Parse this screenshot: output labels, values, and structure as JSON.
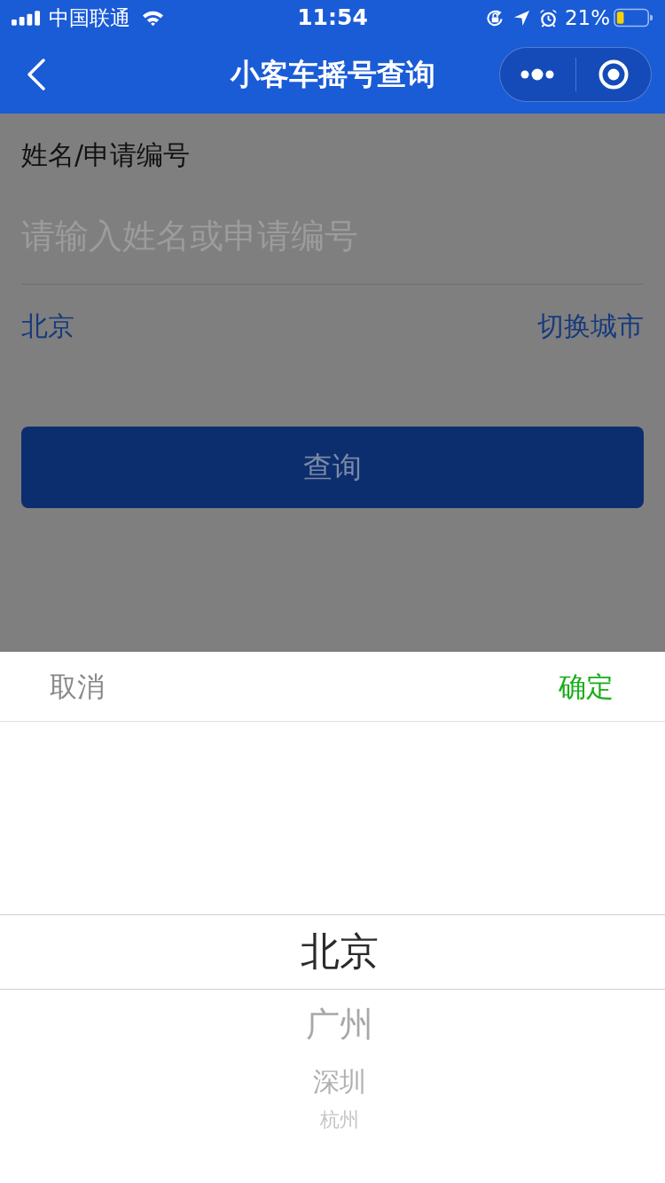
{
  "status_bar": {
    "carrier": "中国联通",
    "time": "11:54",
    "battery": "21%"
  },
  "nav_bar": {
    "title": "小客车摇号查询"
  },
  "form": {
    "label": "姓名/申请编号",
    "input": {
      "placeholder": "请输入姓名或申请编号"
    },
    "city": "北京",
    "switch_city": "切换城市",
    "submit": "查询"
  },
  "picker": {
    "cancel": "取消",
    "confirm": "确定",
    "options": [
      {
        "label": "北京",
        "selected": true
      },
      {
        "label": "广州",
        "selected": false
      },
      {
        "label": "深圳",
        "selected": false
      },
      {
        "label": "杭州",
        "selected": false
      }
    ]
  }
}
